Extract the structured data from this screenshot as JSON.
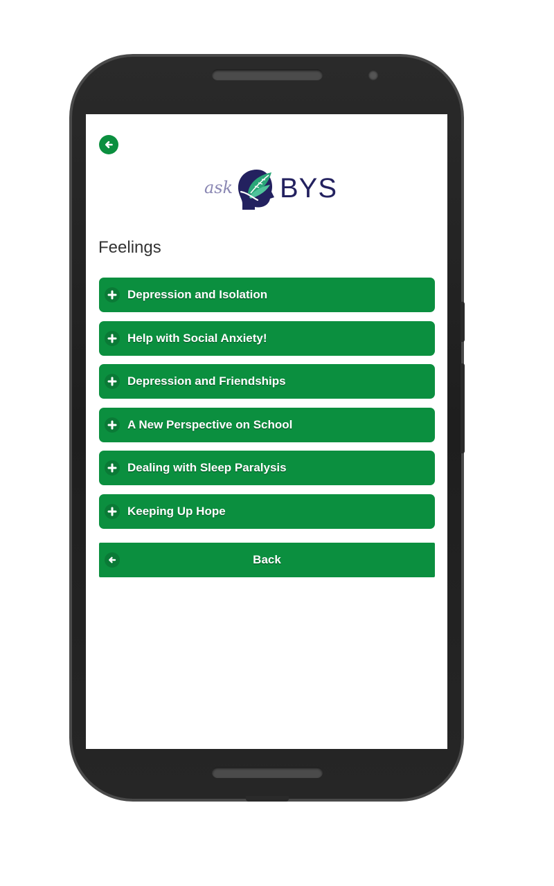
{
  "header": {
    "back_icon": "arrow-left-icon",
    "logo": {
      "ask": "ask",
      "name": "BYS",
      "icon": "leaf-head-icon"
    }
  },
  "main": {
    "title": "Feelings",
    "items": [
      {
        "label": "Depression and Isolation",
        "icon": "plus-icon"
      },
      {
        "label": "Help with Social Anxiety!",
        "icon": "plus-icon"
      },
      {
        "label": "Depression and Friendships",
        "icon": "plus-icon"
      },
      {
        "label": "A New Perspective on School",
        "icon": "plus-icon"
      },
      {
        "label": "Dealing with Sleep Paralysis",
        "icon": "plus-icon"
      },
      {
        "label": "Keeping Up Hope",
        "icon": "plus-icon"
      }
    ],
    "back_button": {
      "label": "Back",
      "icon": "arrow-left-icon"
    }
  },
  "colors": {
    "accent": "#0b8f3f",
    "logo_text": "#23215f",
    "logo_ask": "#8a87b3",
    "phone_frame": "#222222"
  }
}
